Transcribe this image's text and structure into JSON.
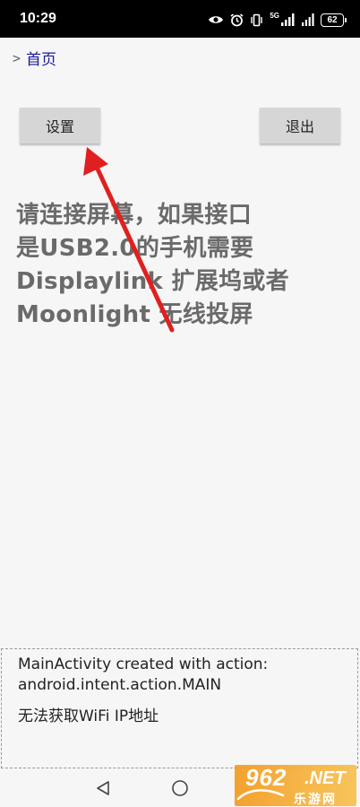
{
  "status_bar": {
    "time": "10:29",
    "network": "5G",
    "battery": "62"
  },
  "breadcrumb": {
    "separator": ">",
    "home_label": "首页"
  },
  "buttons": {
    "settings_label": "设置",
    "exit_label": "退出"
  },
  "message": {
    "lines": [
      "请连接屏幕，如果接口",
      "是USB2.0的手机需要",
      "Displaylink 扩展坞或者",
      "Moonlight 无线投屏"
    ]
  },
  "log": {
    "line1": "MainActivity created with action:",
    "line2": "android.intent.action.MAIN",
    "line3": "无法获取WiFi IP地址"
  },
  "watermark": {
    "brand": "962",
    "suffix": ".NET",
    "site": "乐游网"
  },
  "colors": {
    "annotation_arrow": "#e02020",
    "message_text": "#6a6a6a",
    "breadcrumb_link": "#1a1a9a",
    "button_bg": "#d6d6d6"
  }
}
